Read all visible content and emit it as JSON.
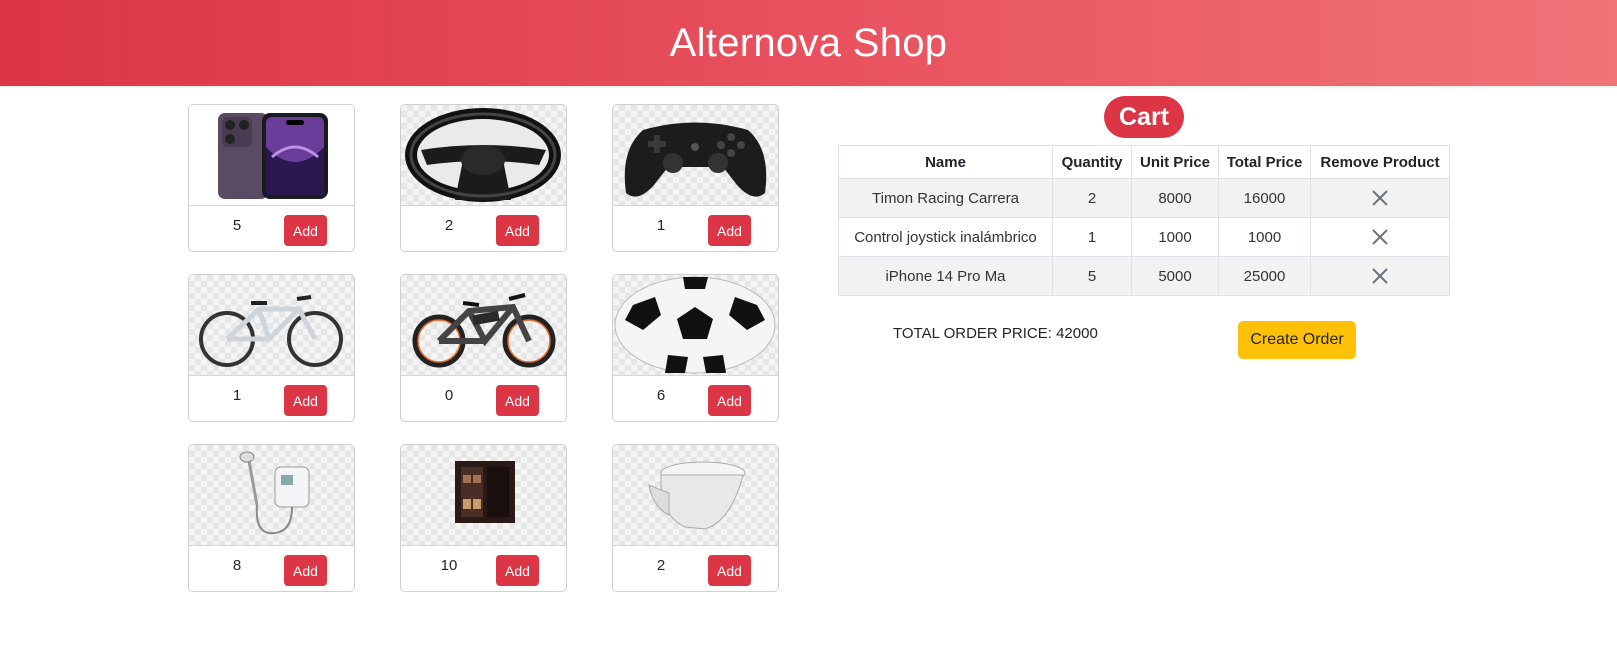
{
  "header": {
    "title": "Alternova Shop"
  },
  "products": [
    {
      "icon": "smartphone-icon",
      "quantity": "5",
      "add_label": "Add"
    },
    {
      "icon": "steering-wheel-icon",
      "quantity": "2",
      "add_label": "Add"
    },
    {
      "icon": "gamepad-icon",
      "quantity": "1",
      "add_label": "Add"
    },
    {
      "icon": "bicycle-icon",
      "quantity": "1",
      "add_label": "Add"
    },
    {
      "icon": "electric-bike-icon",
      "quantity": "0",
      "add_label": "Add"
    },
    {
      "icon": "soccer-ball-icon",
      "quantity": "6",
      "add_label": "Add"
    },
    {
      "icon": "electric-shower-icon",
      "quantity": "8",
      "add_label": "Add"
    },
    {
      "icon": "cabinet-icon",
      "quantity": "10",
      "add_label": "Add"
    },
    {
      "icon": "toilet-icon",
      "quantity": "2",
      "add_label": "Add"
    }
  ],
  "cart": {
    "title": "Cart",
    "columns": [
      "Name",
      "Quantity",
      "Unit Price",
      "Total Price",
      "Remove Product"
    ],
    "rows": [
      {
        "name": "Timon Racing Carrera",
        "quantity": "2",
        "unit_price": "8000",
        "total_price": "16000"
      },
      {
        "name": "Control joystick inalámbrico",
        "quantity": "1",
        "unit_price": "1000",
        "total_price": "1000"
      },
      {
        "name": "iPhone 14 Pro Ma",
        "quantity": "5",
        "unit_price": "5000",
        "total_price": "25000"
      }
    ],
    "total_label": "TOTAL ORDER PRICE: 42000",
    "create_order_label": "Create Order"
  },
  "colors": {
    "accent": "#dc3545",
    "warning": "#ffc107"
  }
}
